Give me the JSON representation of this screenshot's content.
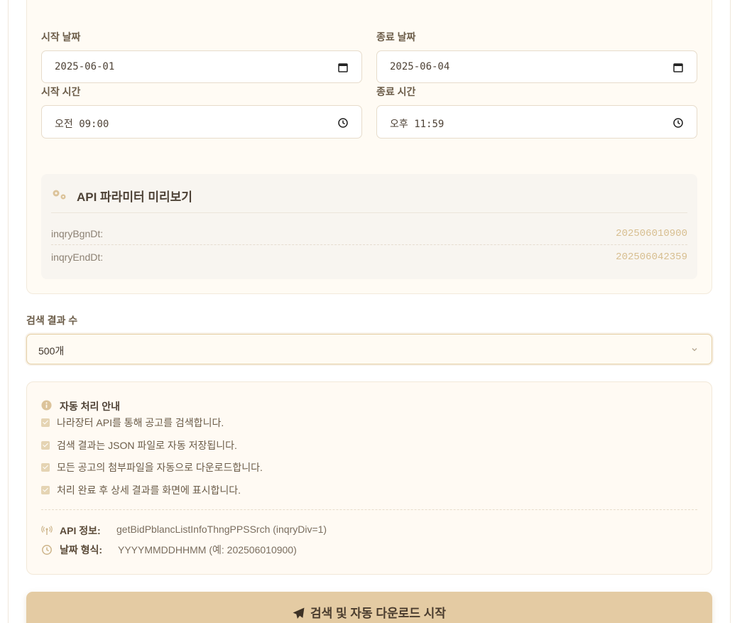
{
  "presets": [
    "",
    "",
    "",
    ""
  ],
  "date_range": {
    "start_date_label": "시작 날짜",
    "start_date_value": "2025-06-01",
    "end_date_label": "종료 날짜",
    "end_date_value": "2025-06-04",
    "start_time_label": "시작 시간",
    "start_time_value": "오전  09:00",
    "end_time_label": "종료 시간",
    "end_time_value": "오후  11:59"
  },
  "preview": {
    "title": "API 파라미터 미리보기",
    "rows": [
      {
        "key": "inqryBgnDt:",
        "value": "202506010900"
      },
      {
        "key": "inqryEndDt:",
        "value": "202506042359"
      }
    ]
  },
  "results": {
    "label": "검색 결과 수",
    "selected": "500개"
  },
  "info": {
    "title": "자동 처리 안내",
    "items": [
      "나라장터 API를 통해 공고를 검색합니다.",
      "검색 결과는 JSON 파일로 자동 저장됩니다.",
      "모든 공고의 첨부파일을 자동으로 다운로드합니다.",
      "처리 완료 후 상세 결과를 화면에 표시합니다."
    ],
    "api_key": "API 정보:",
    "api_value": "getBidPblancListInfoThngPPSSrch (inqryDiv=1)",
    "format_key": "날짜 형식:",
    "format_value": "YYYYMMDDHHMM (예: 202506010900)"
  },
  "submit": {
    "label": "검색 및 자동 다운로드 시작"
  },
  "colors": {
    "accent": "#e4cba3",
    "value_text": "#d7be8f",
    "card_bg": "#fffbf4"
  },
  "icons": [
    "calendar-icon",
    "clock-icon",
    "gears-icon",
    "info-icon",
    "check-icon",
    "antenna-icon",
    "plane-icon",
    "chevron-down-icon"
  ]
}
